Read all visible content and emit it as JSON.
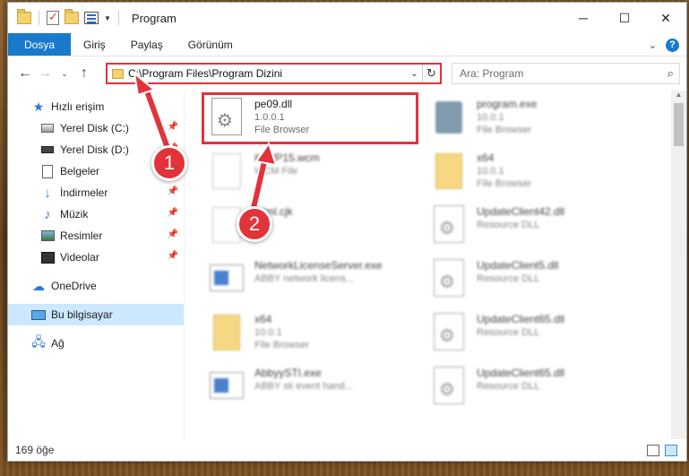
{
  "window": {
    "title": "Program"
  },
  "ribbon": {
    "tabs": [
      "Dosya",
      "Giriş",
      "Paylaş",
      "Görünüm"
    ]
  },
  "address": {
    "path": "C:\\Program Files\\Program Dizini"
  },
  "search": {
    "placeholder": "Ara: Program"
  },
  "sidebar": {
    "items": [
      {
        "label": "Hızlı erişim",
        "icon": "star-icon"
      },
      {
        "label": "Yerel Disk (C:)",
        "icon": "disk-icon",
        "pinned": true
      },
      {
        "label": "Yerel Disk (D:)",
        "icon": "disk-icon",
        "pinned": true
      },
      {
        "label": "Belgeler",
        "icon": "document-icon",
        "pinned": true
      },
      {
        "label": "İndirmeler",
        "icon": "download-icon",
        "pinned": true
      },
      {
        "label": "Müzik",
        "icon": "music-icon",
        "pinned": true
      },
      {
        "label": "Resimler",
        "icon": "pictures-icon",
        "pinned": true
      },
      {
        "label": "Videolar",
        "icon": "videos-icon",
        "pinned": true
      },
      {
        "label": "OneDrive",
        "icon": "cloud-icon"
      },
      {
        "label": "Bu bilgisayar",
        "icon": "computer-icon",
        "selected": true
      },
      {
        "label": "Ağ",
        "icon": "network-icon"
      }
    ]
  },
  "files": [
    {
      "name": "pe09.dll",
      "line2": "1.0.0.1",
      "line3": "File Browser",
      "icon": "dll-icon"
    },
    {
      "name": "program.exe",
      "line2": "10.0.1",
      "line3": "File Browser",
      "icon": "program-icon"
    },
    {
      "name": "ilaWP15.wcm",
      "line2": "WCM File",
      "line3": "",
      "icon": "file-icon"
    },
    {
      "name": "x64",
      "line2": "10.0.1",
      "line3": "File Browser",
      "icon": "folder-icon"
    },
    {
      "name": "tNml.cjk",
      "line2": "File",
      "line3": "",
      "icon": "file-icon"
    },
    {
      "name": "UpdateClient42.dll",
      "line2": "Resource DLL",
      "line3": "",
      "icon": "dll-icon"
    },
    {
      "name": "NetworkLicenseServer.exe",
      "line2": "ABBY network licens...",
      "line3": "",
      "icon": "exe-icon"
    },
    {
      "name": "UpdateClient5.dll",
      "line2": "Resource DLL",
      "line3": "",
      "icon": "dll-icon"
    },
    {
      "name": "x64",
      "line2": "10.0.1",
      "line3": "File Browser",
      "icon": "folder-icon"
    },
    {
      "name": "UpdateClient65.dll",
      "line2": "Resource DLL",
      "line3": "",
      "icon": "dll-icon"
    },
    {
      "name": "AbbyySTI.exe",
      "line2": "ABBY sti event hand...",
      "line3": "",
      "icon": "exe-icon"
    },
    {
      "name": "UpdateClient65.dll",
      "line2": "Resource DLL",
      "line3": "",
      "icon": "dll-icon"
    }
  ],
  "status": {
    "count": "169 öğe"
  },
  "annotations": {
    "step1": "1",
    "step2": "2"
  },
  "colors": {
    "accent": "#1979ca",
    "highlight": "#e2323a",
    "selection": "#cce8ff"
  }
}
